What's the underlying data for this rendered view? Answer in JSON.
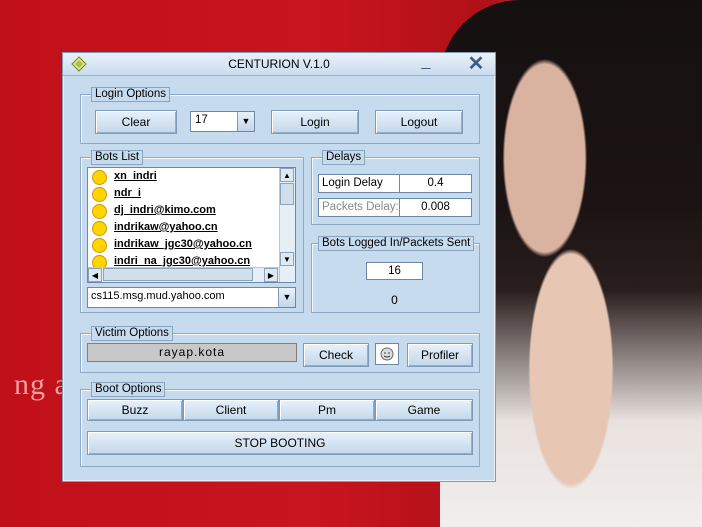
{
  "background": {
    "text": "ng a"
  },
  "window": {
    "title": "CENTURION V.1.0",
    "minimize_glyph": "_",
    "close_glyph": "✕"
  },
  "login_options": {
    "label": "Login Options",
    "clear_label": "Clear",
    "dropdown_value": "17",
    "login_label": "Login",
    "logout_label": "Logout"
  },
  "bots_list": {
    "label": "Bots List",
    "items": [
      "xn_indri",
      "ndr_i",
      "dj_indri@kimo.com",
      "indrikaw@yahoo.cn",
      "indrikaw_jgc30@yahoo.cn",
      "indri_na_jgc30@yahoo.cn"
    ],
    "server_value": "cs115.msg.mud.yahoo.com"
  },
  "delays": {
    "label": "Delays",
    "login_delay_label": "Login Delay",
    "login_delay_value": "0.4",
    "packets_delay_label": "Packets Delay:",
    "packets_delay_value": "0.008"
  },
  "bots_logged": {
    "label": "Bots Logged In/Packets Sent",
    "logged_value": "16",
    "packets_value": "0"
  },
  "victim_options": {
    "label": "Victim Options",
    "victim_value": "rayap.kota",
    "check_label": "Check",
    "profiler_label": "Profiler"
  },
  "boot_options": {
    "label": "Boot Options",
    "buzz_label": "Buzz",
    "client_label": "Client",
    "pm_label": "Pm",
    "game_label": "Game",
    "stop_label": "STOP BOOTING"
  },
  "colors": {
    "window_bg": "#c7dbee",
    "desktop_red": "#c0101a",
    "smiley": "#ffd400"
  }
}
